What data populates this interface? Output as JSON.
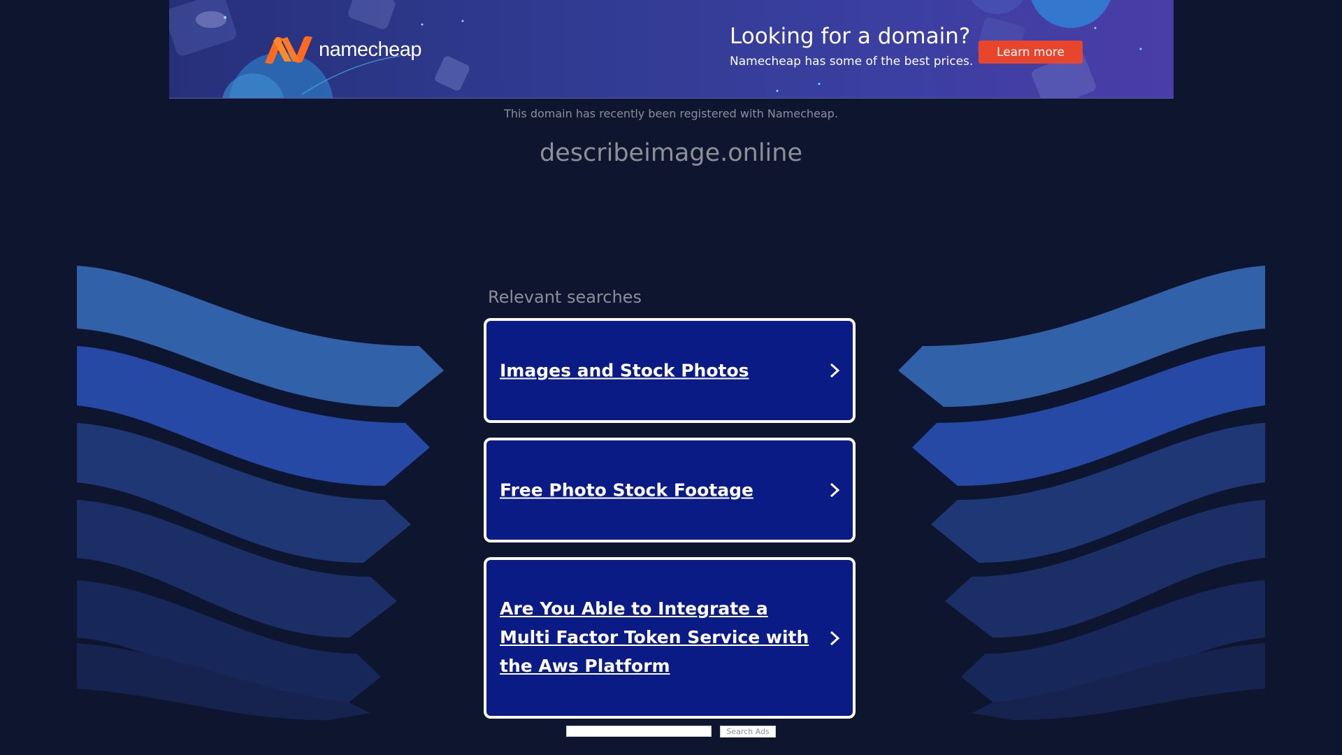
{
  "banner": {
    "brand": "namecheap",
    "headline": "Looking for a domain?",
    "subtext": "Namecheap has some of the best prices.",
    "cta_label": "Learn more"
  },
  "notice": "This domain has recently been registered with Namecheap.",
  "domain": "describeimage.online",
  "relevant": {
    "title": "Relevant searches",
    "items": [
      {
        "label": "Images and Stock Photos"
      },
      {
        "label": "Free Photo Stock Footage"
      },
      {
        "label": "Are You Able to Integrate a Multi Factor Token Service with the Aws Platform"
      }
    ]
  },
  "search": {
    "input_value": "",
    "button_label": "Search Ads"
  },
  "colors": {
    "background": "#0e162f",
    "box_fill": "#0a1b86",
    "cta": "#e7462c",
    "logo_orange": "#ff6a1f"
  }
}
